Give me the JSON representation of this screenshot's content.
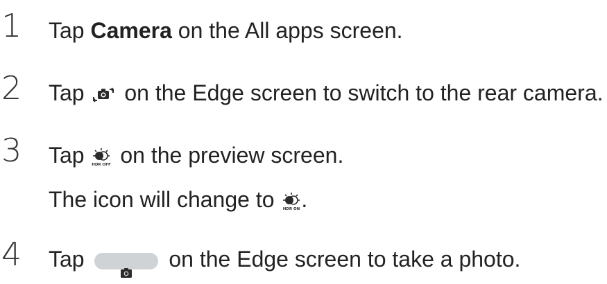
{
  "steps": [
    {
      "number": "1",
      "pre": "Tap ",
      "bold": "Camera",
      "post": " on the All apps screen."
    },
    {
      "number": "2",
      "pre": "Tap ",
      "icon": "switch-camera-icon",
      "post": " on the Edge screen to switch to the rear camera."
    },
    {
      "number": "3",
      "pre": "Tap ",
      "icon": "hdr-off-icon",
      "icon_label": "HDR OFF",
      "post": " on the preview screen.",
      "note_pre": "The icon will change to ",
      "note_icon": "hdr-on-icon",
      "note_icon_label": "HDR ON",
      "note_post": "."
    },
    {
      "number": "4",
      "pre": "Tap ",
      "icon": "shutter-button-icon",
      "post": " on the Edge screen to take a photo."
    }
  ],
  "colors": {
    "text": "#222222",
    "number": "#333333",
    "shutter_bg": "#cfd3d6",
    "icon_dark": "#2b2b2b"
  }
}
